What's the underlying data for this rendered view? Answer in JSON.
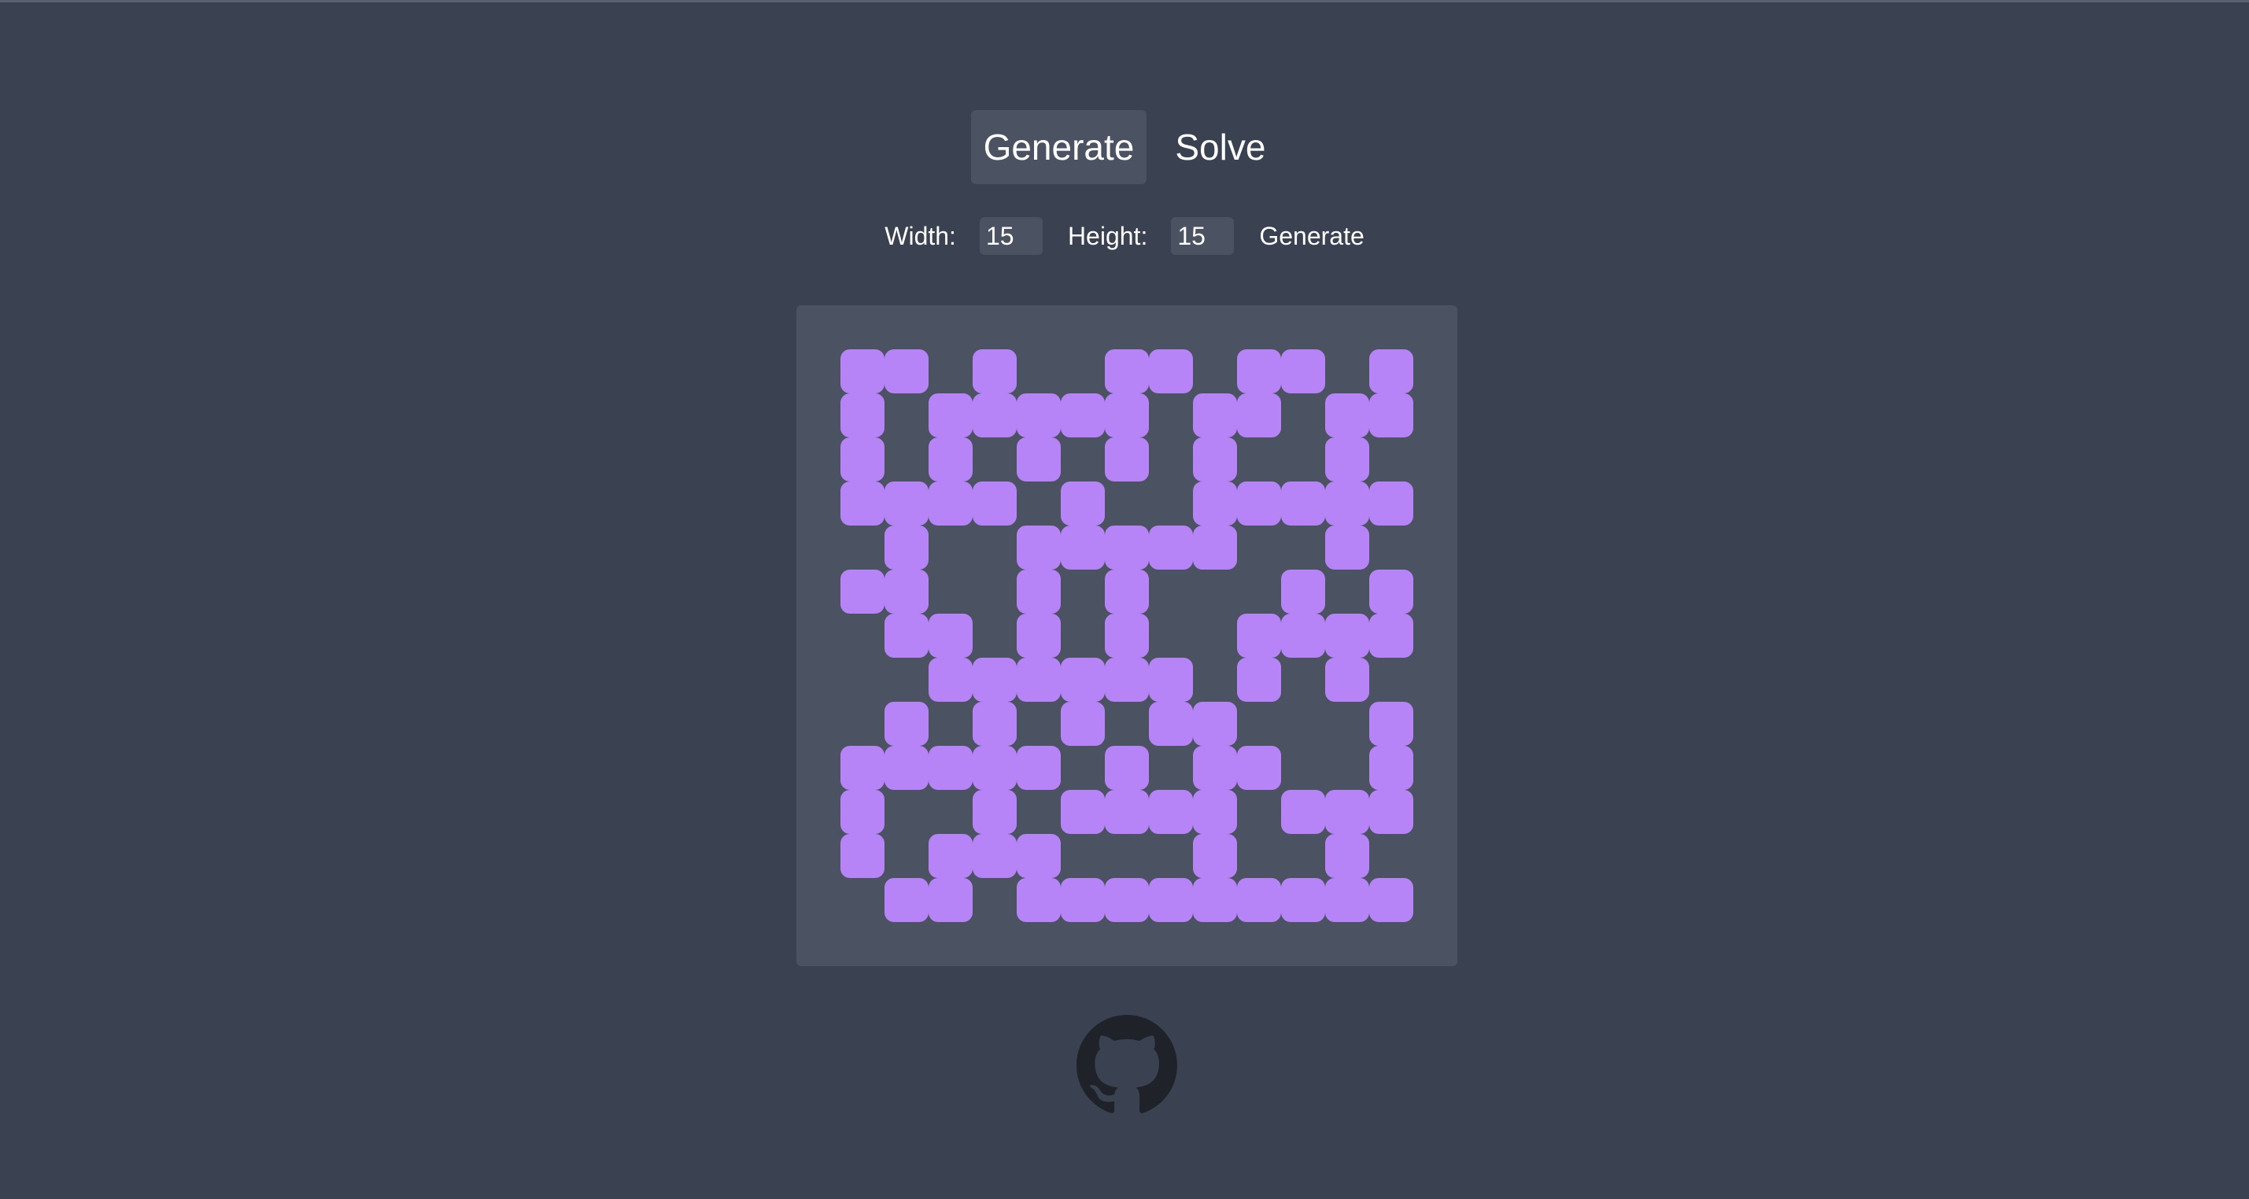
{
  "tabs": {
    "generate_label": "Generate",
    "solve_label": "Solve"
  },
  "controls": {
    "width_label": "Width:",
    "width_value": "15",
    "height_label": "Height:",
    "height_value": "15",
    "generate_label": "Generate"
  },
  "maze": {
    "columns": 13,
    "rows": 13,
    "cell_color": "#b784f7",
    "grid": [
      "1101001101101",
      "1011111011011",
      "1010101010010",
      "1111010011111",
      "0100111110010",
      "1100101000101",
      "0110101001111",
      "0011111101010",
      "0101010110001",
      "1111101011001",
      "1001011110111",
      "1011100010010",
      "0110111111111"
    ]
  },
  "footer": {
    "icon": "github-icon"
  },
  "colors": {
    "background": "#3a4150",
    "panel": "#4b5363",
    "accent": "#b784f7"
  }
}
